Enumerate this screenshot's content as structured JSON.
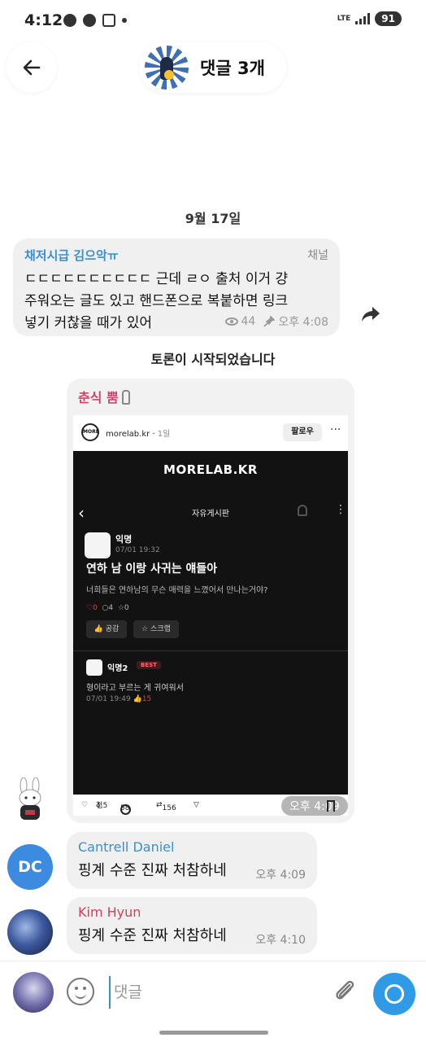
{
  "status_bar": {
    "time": "4:12",
    "network": "LTE",
    "battery": "91",
    "icons": [
      "talk-icon",
      "chatgpt-icon",
      "screen-record-icon",
      "dot-icon"
    ]
  },
  "header": {
    "title": "댓글 3개"
  },
  "date_separator": "9월 17일",
  "channel_post": {
    "sender": "채저시급 김으악ㅠ",
    "tag": "채널",
    "text": "ㄷㄷㄷㄷㄷㄷㄷㄷㄷㄷ 근데 ㄹㅇ 출처 이거 걍 주워오는 글도 있고 핸드폰으로 복붙하면 링크넣기 커찮을 때가 있어",
    "views": "44",
    "time": "오후 4:08"
  },
  "service_message": "토론이 시작되었습니다",
  "forwarded": {
    "sender": "춘식 뿜",
    "time": "오후 4:09",
    "instagram": {
      "logo_text": "MORE",
      "account": "morelab.kr",
      "age": "1일",
      "follow_label": "팔로우",
      "likes": "4.5",
      "likes_unit": "천",
      "comments": "58",
      "reposts": "156",
      "screenshot": {
        "brand": "MORELAB.KR",
        "board": "자유게시판",
        "author": "익명",
        "date": "07/01 19:32",
        "title": "연하 남 이랑 사귀는 얘들아",
        "body": "너희들은 연하남의 무슨 매력을 느꼈어서 만나는거야?",
        "like_count": "0",
        "comment_count": "4",
        "scrap_count": "0",
        "like_button": "공감",
        "scrap_button": "스크랩",
        "comment_author": "익명2",
        "best_label": "BEST",
        "comment_text": "형이라고 부르는 게 귀여워서",
        "comment_date": "07/01 19:49",
        "comment_likes": "15"
      }
    }
  },
  "messages": [
    {
      "avatar": "DC",
      "name": "Cantrell Daniel",
      "text": "핑계 수준 진짜 처참하네",
      "time": "오후 4:09",
      "name_color": "#3a8fd0"
    },
    {
      "avatar": "",
      "name": "Kim Hyun",
      "text": "핑계 수준 진짜 처참하네",
      "time": "오후 4:10",
      "name_color": "#d0405a"
    }
  ],
  "composer": {
    "placeholder": "댓글"
  },
  "colors": {
    "accent": "#2f9ae6",
    "channel_name": "#3a8fd0",
    "forwarded_name": "#d2436b",
    "bubble": "#f0f0f0"
  }
}
